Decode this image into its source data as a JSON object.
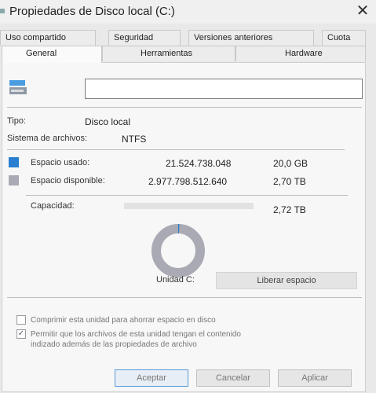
{
  "window": {
    "title": "Propiedades de Disco local (C:)"
  },
  "tabs_row1": [
    {
      "label": "Uso compartido"
    },
    {
      "label": "Seguridad"
    },
    {
      "label": "Versiones anteriores"
    },
    {
      "label": "Cuota"
    }
  ],
  "tabs_row2": [
    {
      "label": "General",
      "active": true
    },
    {
      "label": "Herramientas"
    },
    {
      "label": "Hardware"
    }
  ],
  "general": {
    "drive_name_value": "",
    "type_label": "Tipo:",
    "type_value": "Disco local",
    "fs_label": "Sistema de archivos:",
    "fs_value": "NTFS",
    "used_label": "Espacio usado:",
    "used_bytes": "21.524.738.048",
    "used_size": "20,0 GB",
    "free_label": "Espacio disponible:",
    "free_bytes": "2.977.798.512.640",
    "free_size": "2,70 TB",
    "capacity_label": "Capacidad:",
    "capacity_size": "2,72 TB",
    "drive_label": "Unidad C:",
    "free_space_button": "Liberar espacio",
    "used_fraction": 0.0072,
    "used_color": "#2a7fd1",
    "free_color": "#a9aab3"
  },
  "options": {
    "compress_label": "Comprimir esta unidad para ahorrar espacio en disco",
    "compress_checked": false,
    "index_label_line1": "Permitir que los archivos de esta unidad tengan el contenido",
    "index_label_line2": "indizado además de las propiedades de archivo",
    "index_checked": true
  },
  "buttons": {
    "ok": "Aceptar",
    "cancel": "Cancelar",
    "apply": "Aplicar"
  }
}
